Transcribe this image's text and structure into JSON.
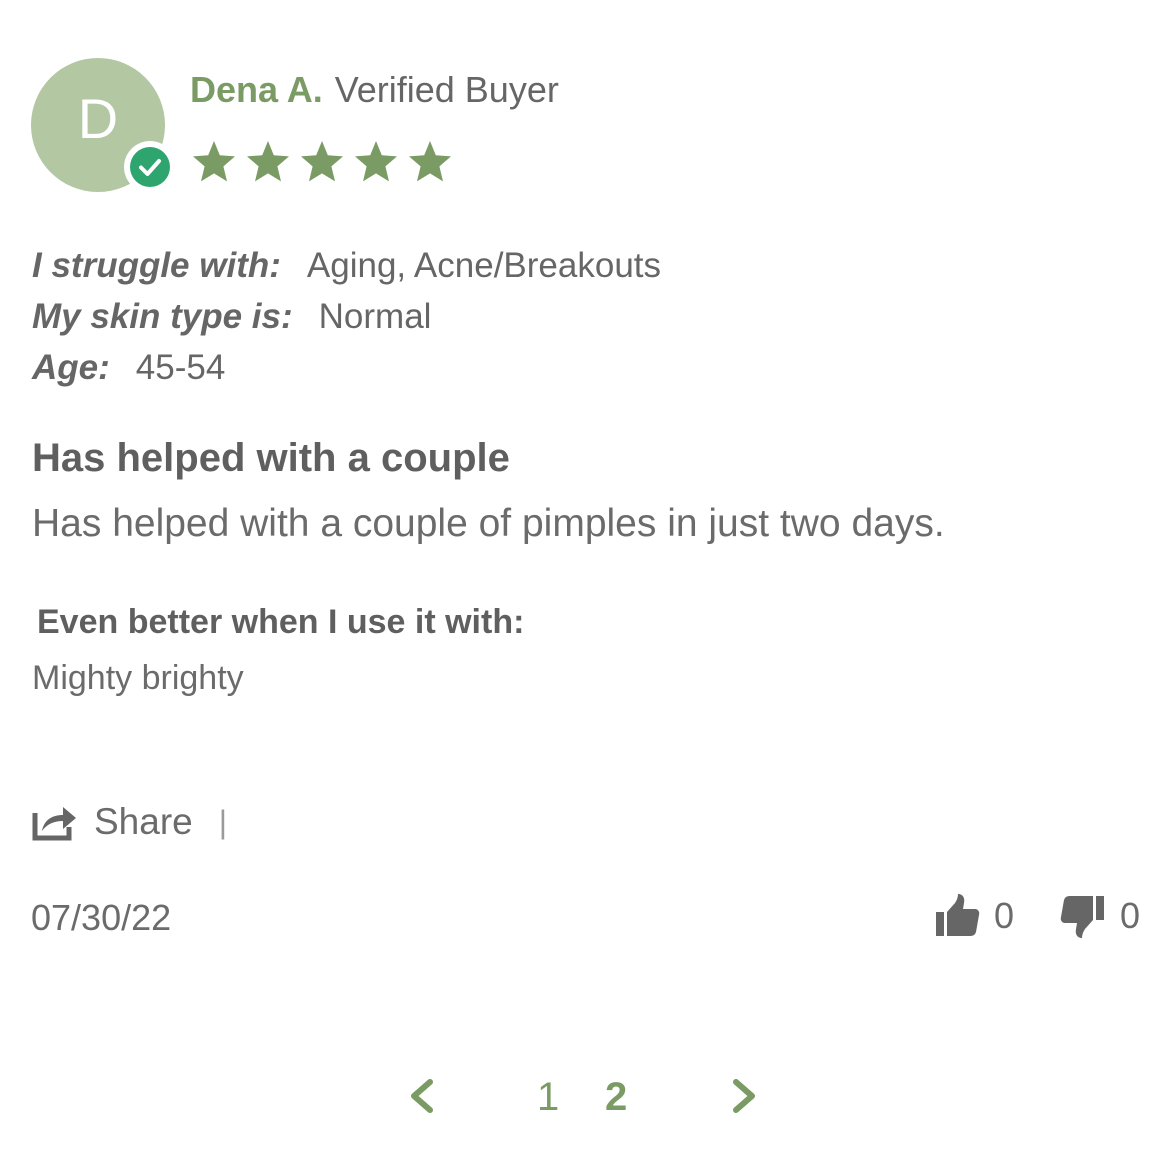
{
  "author": {
    "initial": "D",
    "name": "Dena A.",
    "status": "Verified Buyer",
    "rating": 5,
    "rating_max": 5
  },
  "attributes": [
    {
      "label": "I struggle with:",
      "value": "Aging, Acne/Breakouts"
    },
    {
      "label": "My skin type is:",
      "value": "Normal"
    },
    {
      "label": "Age:",
      "value": "45-54"
    }
  ],
  "review": {
    "title": "Has helped with a couple",
    "text": "Has helped with a couple of pimples in just two days."
  },
  "extra": {
    "label": "Even better when I use it with:",
    "value": "Mighty brighty"
  },
  "actions": {
    "share_label": "Share",
    "divider": "|"
  },
  "footer": {
    "date": "07/30/22",
    "thumbs_up_count": "0",
    "thumbs_down_count": "0"
  },
  "pagination": {
    "pages": [
      "1",
      "2"
    ],
    "current": "2"
  },
  "icons": {
    "verified": "check-circle-icon",
    "star": "star-icon",
    "share": "share-icon",
    "thumbs_up": "thumbs-up-icon",
    "thumbs_down": "thumbs-down-icon",
    "prev": "chevron-left-icon",
    "next": "chevron-right-icon"
  },
  "colors": {
    "accent_green": "#7a9b63",
    "avatar_bg": "#b3c7a3",
    "verified_green": "#2ea56f",
    "text_gray": "#6b6b6b",
    "icon_gray": "#666666"
  }
}
